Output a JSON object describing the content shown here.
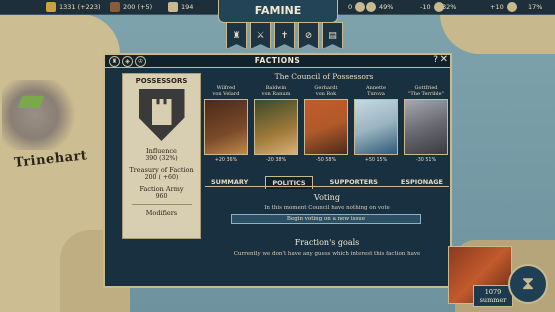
{
  "topbar": {
    "resources": [
      {
        "icon": "treasury-icon",
        "value": "1331 (+223)",
        "color": "#c9a33a"
      },
      {
        "icon": "army-icon",
        "value": "200 (+5)",
        "color": "#8a5a3a"
      },
      {
        "icon": "crown-icon",
        "value": "194",
        "color": "#c9b98f"
      },
      {
        "icon": "stability-icon",
        "value": "0",
        "color": "#c9b98f"
      },
      {
        "icon": "justice-icon",
        "value": "49%",
        "color": "#c9b98f"
      },
      {
        "icon": "influence-icon",
        "value": "-10",
        "color": "#c9b98f"
      },
      {
        "icon": "favor-icon",
        "value": "32%",
        "color": "#c9b98f"
      },
      {
        "icon": "food-icon",
        "value": "+10",
        "color": "#c9b98f"
      },
      {
        "icon": "church-icon",
        "value": "17%",
        "color": "#c9b98f"
      }
    ],
    "event": "FAMINE"
  },
  "map": {
    "town": "Trinehart"
  },
  "window": {
    "title": "FACTIONS",
    "help": "?",
    "close": "✕",
    "panel": {
      "title": "POSSESSORS",
      "influence_label": "Influence",
      "influence_value": "390 (32%)",
      "treasury_label": "Treasury of Faction",
      "treasury_value": "200 ( +60)",
      "army_label": "Faction Army",
      "army_value": "960",
      "modifiers_label": "Modifiers"
    },
    "council_title": "The Council of Possessors",
    "members": [
      {
        "name_line1": "Wilfred",
        "name_line2": "von Velard",
        "stats": "+20   36%",
        "color": "#7a4a2a"
      },
      {
        "name_line1": "Baldwin",
        "name_line2": "von Ranum",
        "stats": "-20   38%",
        "color": "#a07a3a"
      },
      {
        "name_line1": "Gerhardt",
        "name_line2": "von Rok",
        "stats": "-50   58%",
        "color": "#b05a2a"
      },
      {
        "name_line1": "Annette",
        "name_line2": "Turova",
        "stats": "+50   15%",
        "color": "#9ab4c0"
      },
      {
        "name_line1": "Gottfried",
        "name_line2": "\"The Terrible\"",
        "stats": "-30   51%",
        "color": "#6a6a72"
      }
    ],
    "tabs": [
      {
        "label": "SUMMARY",
        "active": false
      },
      {
        "label": "POLITICS",
        "active": true
      },
      {
        "label": "SUPPORTERS",
        "active": false
      },
      {
        "label": "ESPIONAGE",
        "active": false
      }
    ],
    "voting_title": "Voting",
    "voting_sub": "In this moment Council have nothing on vote",
    "vote_button": "Begin voting on a new issue",
    "goals_title": "Fraction's goals",
    "goals_sub": "Currently we don't have any guess which interest this faction have"
  },
  "date": {
    "year": "1079",
    "season": "summer"
  }
}
